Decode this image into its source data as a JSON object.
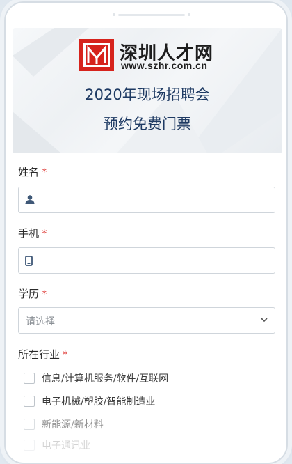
{
  "header": {
    "logo_text": "深圳人才网",
    "logo_url": "www.szhr.com.cn",
    "title_line1": "2020年现场招聘会",
    "title_line2": "预约免费门票",
    "brand_red": "#d6231c",
    "title_color": "#1e3a63"
  },
  "form": {
    "required_mark": "*",
    "name": {
      "label": "姓名",
      "icon": "user-icon",
      "value": ""
    },
    "phone": {
      "label": "手机",
      "icon": "mobile-phone-icon",
      "value": ""
    },
    "education": {
      "label": "学历",
      "placeholder": "请选择",
      "icon": "chevron-down-icon"
    },
    "industry": {
      "label": "所在行业",
      "options": [
        "信息/计算机服务/软件/互联网",
        "电子机械/塑胶/智能制造业",
        "新能源/新材料",
        "电子通讯业"
      ]
    }
  }
}
